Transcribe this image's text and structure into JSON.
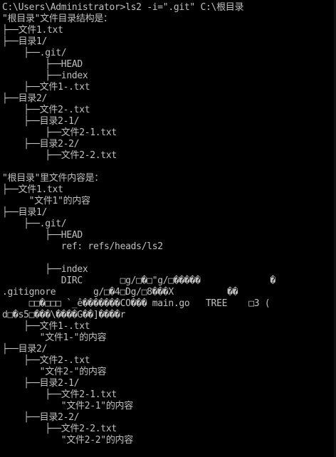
{
  "terminal": {
    "colors": {
      "background": "#000000",
      "foreground": "#c0c0c0"
    },
    "lines": [
      "C:\\Users\\Administrator>ls2 -i=\".git\" C:\\根目录",
      "\"根目录\"文件目录结构是：",
      "├──文件1.txt",
      "├──目录1/",
      "    ├──.git/",
      "        ├──HEAD",
      "        ├──index",
      "    ├──文件1-.txt",
      "├──目录2/",
      "    ├──文件2-.txt",
      "    ├──目录2-1/",
      "        ├──文件2-1.txt",
      "    ├──目录2-2/",
      "        ├──文件2-2.txt",
      "",
      "\"根目录\"里文件内容是：",
      "├──文件1.txt",
      "     \"文件1\"的内容",
      "├──目录1/",
      "    ├──.git/",
      "        ├──HEAD",
      "           ref: refs/heads/ls2",
      "",
      "        ├──index",
      "           DIRC       □g/□�□\"g/□�����             �",
      ".gitignore       g/□�4□Dg/□8���X          ��",
      "     □□�□□□ `_ê�������CO��� main.go   TREE    □3 (",
      "d□�s5□���\\����G��]����r",
      "    ├──文件1-.txt",
      "       \"文件1-\"的内容",
      "├──目录2/",
      "    ├──文件2-.txt",
      "       \"文件2-\"的内容",
      "    ├──目录2-1/",
      "        ├──文件2-1.txt",
      "           \"文件2-1\"的内容",
      "    ├──目录2-2/",
      "        ├──文件2-2.txt",
      "           \"文件2-2\"的内容"
    ]
  }
}
